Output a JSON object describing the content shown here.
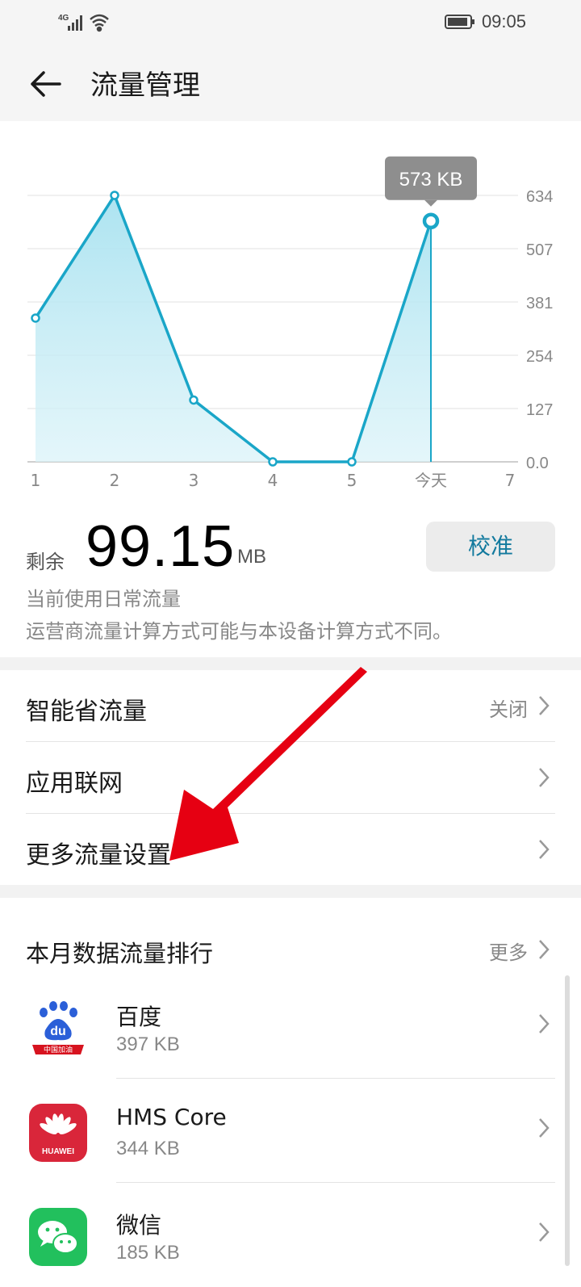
{
  "status_bar": {
    "network": "4G",
    "time": "09:05"
  },
  "header": {
    "title": "流量管理",
    "back_icon": "arrow-left-icon"
  },
  "chart_data": {
    "type": "area",
    "x": [
      "1",
      "2",
      "3",
      "4",
      "5",
      "今天",
      "7"
    ],
    "series": [
      {
        "values": [
          342,
          634,
          147,
          0,
          0,
          573
        ]
      }
    ],
    "y_ticks": [
      "634",
      "507",
      "381",
      "254",
      "127",
      "0.0"
    ],
    "ylim": [
      0,
      634
    ],
    "tooltip": "573 KB",
    "highlight_index": 5,
    "grid": true,
    "color": "#1aa6c8"
  },
  "remaining": {
    "label": "剩余",
    "value": "99.15",
    "unit": "MB",
    "calibrate_label": "校准",
    "note_mode": "当前使用日常流量",
    "note_diff": "运营商流量计算方式可能与本设备计算方式不同。"
  },
  "settings": [
    {
      "label": "智能省流量",
      "value": "关闭"
    },
    {
      "label": "应用联网",
      "value": ""
    },
    {
      "label": "更多流量设置",
      "value": ""
    }
  ],
  "ranking": {
    "title": "本月数据流量排行",
    "more_label": "更多",
    "apps": [
      {
        "name": "百度",
        "size": "397 KB",
        "icon": "baidu-icon",
        "icon_text": "中国加油"
      },
      {
        "name": "HMS Core",
        "size": "344 KB",
        "icon": "huawei-icon",
        "icon_text": "HUAWEI"
      },
      {
        "name": "微信",
        "size": "185 KB",
        "icon": "wechat-icon"
      }
    ]
  },
  "colors": {
    "accent": "#137a9e",
    "chart_line": "#1aa6c8",
    "arrow": "#e60012"
  }
}
